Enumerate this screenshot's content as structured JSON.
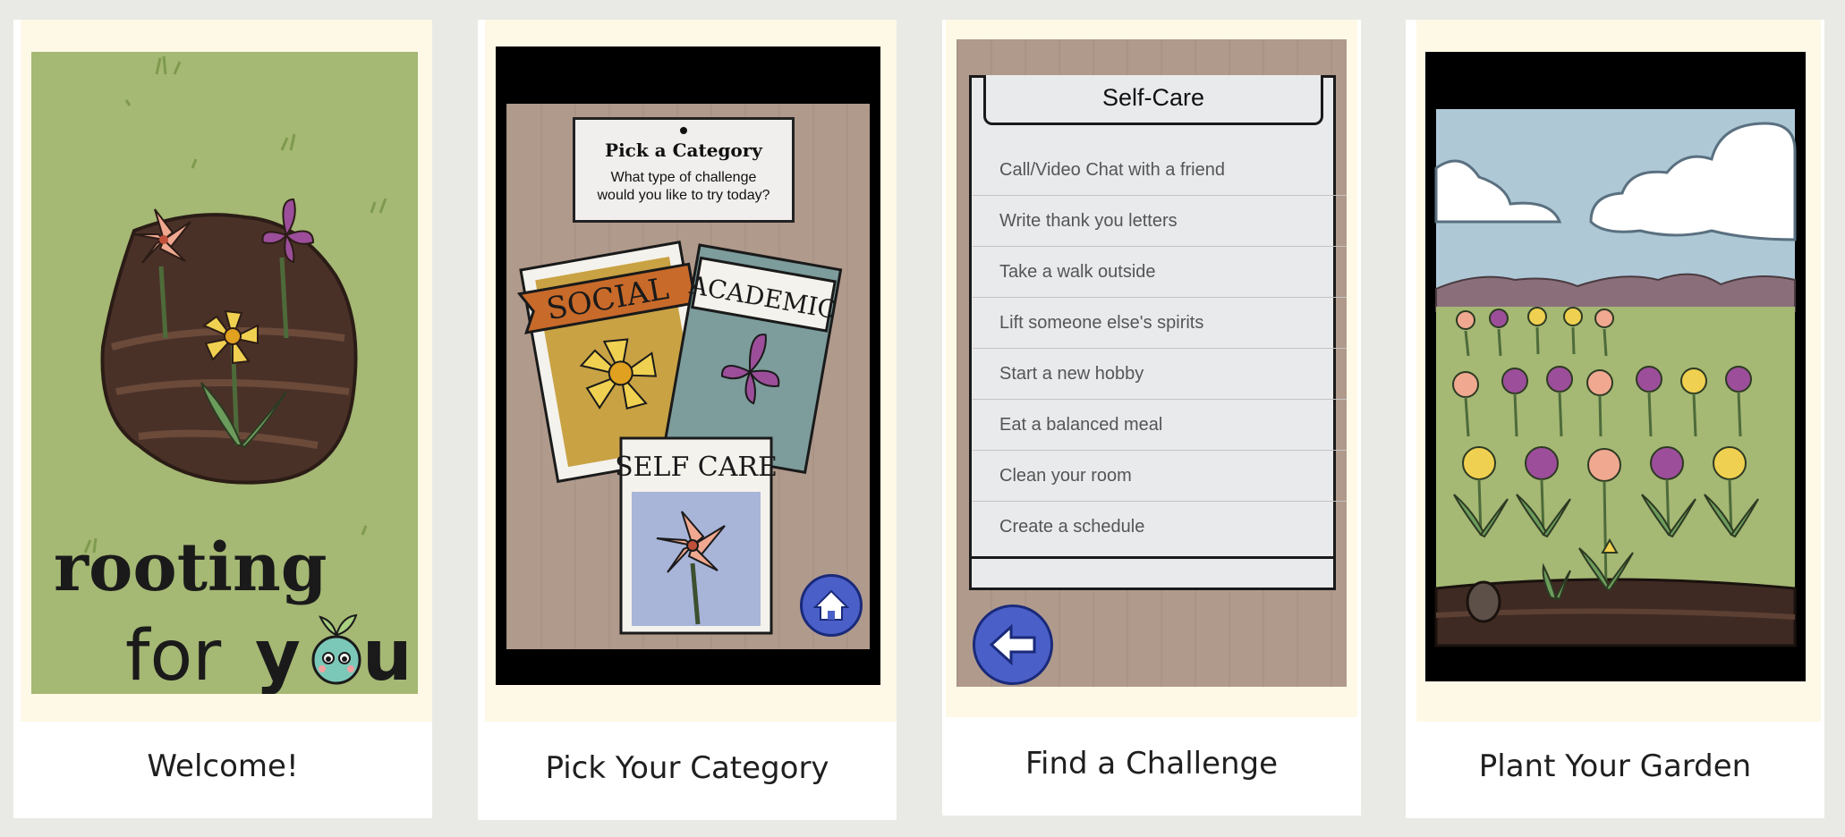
{
  "cards": [
    {
      "caption": "Welcome!",
      "screen": {
        "logo_line1": "rooting",
        "logo_line2_a": "for",
        "logo_line2_b": "y",
        "logo_line2_c": "u"
      }
    },
    {
      "caption": "Pick Your Category",
      "screen": {
        "title": "Pick a Category",
        "subtitle_line1": "What type of challenge",
        "subtitle_line2": "would you like to try today?",
        "packets": [
          "SOCIAL",
          "ACADEMIC",
          "SELF CARE"
        ]
      }
    },
    {
      "caption": "Find a Challenge",
      "screen": {
        "header": "Self-Care",
        "items": [
          "Call/Video Chat with a friend",
          "Write thank you letters",
          "Take a walk outside",
          "Lift someone else's spirits",
          "Start a new hobby",
          "Eat a balanced meal",
          "Clean your room",
          "Create a schedule"
        ]
      }
    },
    {
      "caption": "Plant Your Garden"
    }
  ],
  "colors": {
    "page_bg": "#e9e9e5",
    "card_bg": "#ffffff",
    "frame_bg": "#fdf9e6",
    "grass": "#a5b874",
    "wood": "#b09a8c",
    "button_blue": "#4a5fc8",
    "sky": "#aec8d6"
  },
  "icons": [
    "home-icon",
    "back-arrow-icon",
    "seedling-icon"
  ]
}
